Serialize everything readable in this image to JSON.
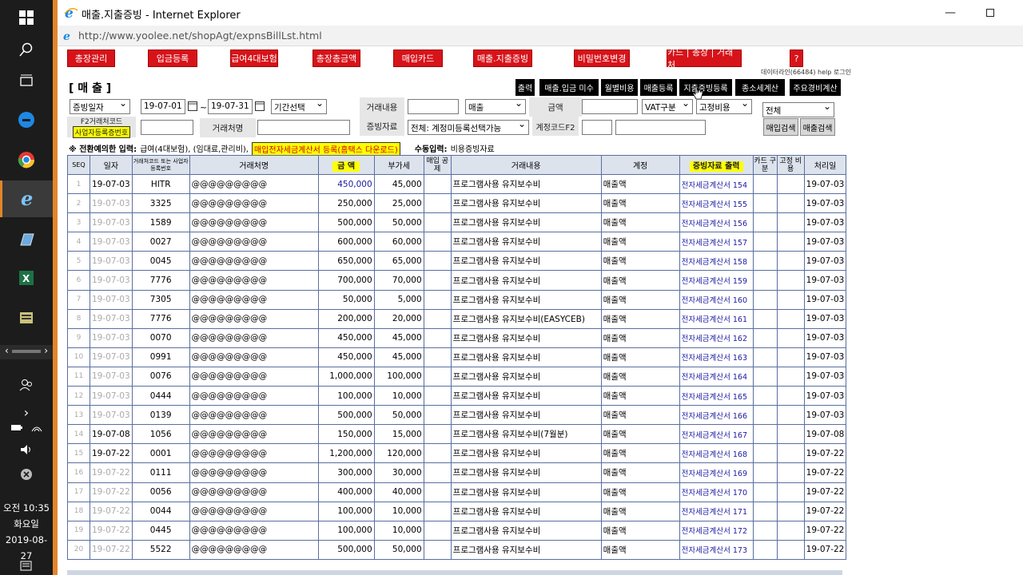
{
  "taskbar": {
    "clock_time": "오전 10:35",
    "clock_day": "화요일",
    "clock_date": "2019-08-27"
  },
  "window": {
    "title": "매출.지출증빙 - Internet Explorer",
    "url": "http://www.yoolee.net/shopAgt/expnsBillLst.html"
  },
  "menu": [
    "총장관리",
    "입금등록",
    "급여4대보험",
    "총장총금액",
    "매입카드",
    "매출.지출증빙",
    "비밀번호변경",
    "카드 | 총장 | 거래처",
    "?"
  ],
  "login_line": "데이터라인(66484) help 로그인",
  "heading": "[ 매 출 ]",
  "actions": [
    "출력",
    "매출.입금 미수",
    "월별비용",
    "매출등록",
    "지출증빙등록",
    "종소세계산",
    "주요경비계산"
  ],
  "filters": {
    "date_type": "증빙일자",
    "date_from": "19-07-01",
    "tilde": "~",
    "date_to": "19-07-31",
    "period_select": "기간선택",
    "trade_label": "거래내용",
    "sales_select": "매출",
    "amount_label": "금액",
    "vat_select": "VAT구분",
    "fixed_select": "고정비용",
    "all_select": "전체",
    "f2_label": "F2거래처코드",
    "biz_label": "사업자등록증번호",
    "partner_label": "거래처명",
    "evidence_label": "증빙자료",
    "evidence_select": "전체: 계정미등록선택가능",
    "account_label": "계정코드F2",
    "buy_search": "매입검색",
    "sell_search": "매출검색"
  },
  "notice": {
    "prefix": "※ 전환예의한 입력:",
    "items": "급여(4대보험), (임대료,관리비),",
    "highlight": "매입전자세금계산서 등록(홈택스 다운로드)",
    "manual_label": "수동입력:",
    "manual_value": "비용증빙자료"
  },
  "table": {
    "headers": [
      "SEQ",
      "일자",
      "거래처코드 또는 사업자등록번호",
      "거래처명",
      "금 액",
      "부가세",
      "매입 공제",
      "거래내용",
      "계정",
      "증빙자료 출력",
      "카드 구분",
      "고정 비용",
      "처리일"
    ],
    "rows": [
      {
        "seq": "1",
        "date": "19-07-03",
        "code": "HITR",
        "name": "@@@@@@@@@",
        "amount": "450,000",
        "vat": "45,000",
        "desc": "프로그램사용 유지보수비",
        "account": "매출액",
        "bill": "전자세금계산서 154",
        "proc": "19-07-03"
      },
      {
        "seq": "2",
        "date": "19-07-03",
        "code": "3325",
        "name": "@@@@@@@@@",
        "amount": "250,000",
        "vat": "25,000",
        "desc": "프로그램사용 유지보수비",
        "account": "매출액",
        "bill": "전자세금계산서 155",
        "proc": "19-07-03"
      },
      {
        "seq": "3",
        "date": "19-07-03",
        "code": "1589",
        "name": "@@@@@@@@@",
        "amount": "500,000",
        "vat": "50,000",
        "desc": "프로그램사용 유지보수비",
        "account": "매출액",
        "bill": "전자세금계산서 156",
        "proc": "19-07-03"
      },
      {
        "seq": "4",
        "date": "19-07-03",
        "code": "0027",
        "name": "@@@@@@@@@",
        "amount": "600,000",
        "vat": "60,000",
        "desc": "프로그램사용 유지보수비",
        "account": "매출액",
        "bill": "전자세금계산서 157",
        "proc": "19-07-03"
      },
      {
        "seq": "5",
        "date": "19-07-03",
        "code": "0045",
        "name": "@@@@@@@@@",
        "amount": "650,000",
        "vat": "65,000",
        "desc": "프로그램사용 유지보수비",
        "account": "매출액",
        "bill": "전자세금계산서 158",
        "proc": "19-07-03"
      },
      {
        "seq": "6",
        "date": "19-07-03",
        "code": "7776",
        "name": "@@@@@@@@@",
        "amount": "700,000",
        "vat": "70,000",
        "desc": "프로그램사용 유지보수비",
        "account": "매출액",
        "bill": "전자세금계산서 159",
        "proc": "19-07-03"
      },
      {
        "seq": "7",
        "date": "19-07-03",
        "code": "7305",
        "name": "@@@@@@@@@",
        "amount": "50,000",
        "vat": "5,000",
        "desc": "프로그램사용 유지보수비",
        "account": "매출액",
        "bill": "전자세금계산서 160",
        "proc": "19-07-03"
      },
      {
        "seq": "8",
        "date": "19-07-03",
        "code": "7776",
        "name": "@@@@@@@@@",
        "amount": "200,000",
        "vat": "20,000",
        "desc": "프로그램사용 유지보수비(EASYCEB)",
        "account": "매출액",
        "bill": "전자세금계산서 161",
        "proc": "19-07-03"
      },
      {
        "seq": "9",
        "date": "19-07-03",
        "code": "0070",
        "name": "@@@@@@@@@",
        "amount": "450,000",
        "vat": "45,000",
        "desc": "프로그램사용 유지보수비",
        "account": "매출액",
        "bill": "전자세금계산서 162",
        "proc": "19-07-03"
      },
      {
        "seq": "10",
        "date": "19-07-03",
        "code": "0991",
        "name": "@@@@@@@@@",
        "amount": "450,000",
        "vat": "45,000",
        "desc": "프로그램사용 유지보수비",
        "account": "매출액",
        "bill": "전자세금계산서 163",
        "proc": "19-07-03"
      },
      {
        "seq": "11",
        "date": "19-07-03",
        "code": "0076",
        "name": "@@@@@@@@@",
        "amount": "1,000,000",
        "vat": "100,000",
        "desc": "프로그램사용 유지보수비",
        "account": "매출액",
        "bill": "전자세금계산서 164",
        "proc": "19-07-03"
      },
      {
        "seq": "12",
        "date": "19-07-03",
        "code": "0444",
        "name": "@@@@@@@@@",
        "amount": "100,000",
        "vat": "10,000",
        "desc": "프로그램사용 유지보수비",
        "account": "매출액",
        "bill": "전자세금계산서 165",
        "proc": "19-07-03"
      },
      {
        "seq": "13",
        "date": "19-07-03",
        "code": "0139",
        "name": "@@@@@@@@@",
        "amount": "500,000",
        "vat": "50,000",
        "desc": "프로그램사용 유지보수비",
        "account": "매출액",
        "bill": "전자세금계산서 166",
        "proc": "19-07-03"
      },
      {
        "seq": "14",
        "date": "19-07-08",
        "code": "1056",
        "name": "@@@@@@@@@",
        "amount": "150,000",
        "vat": "15,000",
        "desc": "프로그램사용 유지보수비(7월분)",
        "account": "매출액",
        "bill": "전자세금계산서 167",
        "proc": "19-07-08"
      },
      {
        "seq": "15",
        "date": "19-07-22",
        "code": "0001",
        "name": "@@@@@@@@@",
        "amount": "1,200,000",
        "vat": "120,000",
        "desc": "프로그램사용 유지보수비",
        "account": "매출액",
        "bill": "전자세금계산서 168",
        "proc": "19-07-22"
      },
      {
        "seq": "16",
        "date": "19-07-22",
        "code": "0111",
        "name": "@@@@@@@@@",
        "amount": "300,000",
        "vat": "30,000",
        "desc": "프로그램사용 유지보수비",
        "account": "매출액",
        "bill": "전자세금계산서 169",
        "proc": "19-07-22"
      },
      {
        "seq": "17",
        "date": "19-07-22",
        "code": "0056",
        "name": "@@@@@@@@@",
        "amount": "400,000",
        "vat": "40,000",
        "desc": "프로그램사용 유지보수비",
        "account": "매출액",
        "bill": "전자세금계산서 170",
        "proc": "19-07-22"
      },
      {
        "seq": "18",
        "date": "19-07-22",
        "code": "0044",
        "name": "@@@@@@@@@",
        "amount": "100,000",
        "vat": "10,000",
        "desc": "프로그램사용 유지보수비",
        "account": "매출액",
        "bill": "전자세금계산서 171",
        "proc": "19-07-22"
      },
      {
        "seq": "19",
        "date": "19-07-22",
        "code": "0445",
        "name": "@@@@@@@@@",
        "amount": "100,000",
        "vat": "10,000",
        "desc": "프로그램사용 유지보수비",
        "account": "매출액",
        "bill": "전자세금계산서 172",
        "proc": "19-07-22"
      },
      {
        "seq": "20",
        "date": "19-07-22",
        "code": "5522",
        "name": "@@@@@@@@@",
        "amount": "500,000",
        "vat": "50,000",
        "desc": "프로그램사용 유지보수비",
        "account": "매출액",
        "bill": "전자세금계산서 173",
        "proc": "19-07-22"
      }
    ]
  }
}
